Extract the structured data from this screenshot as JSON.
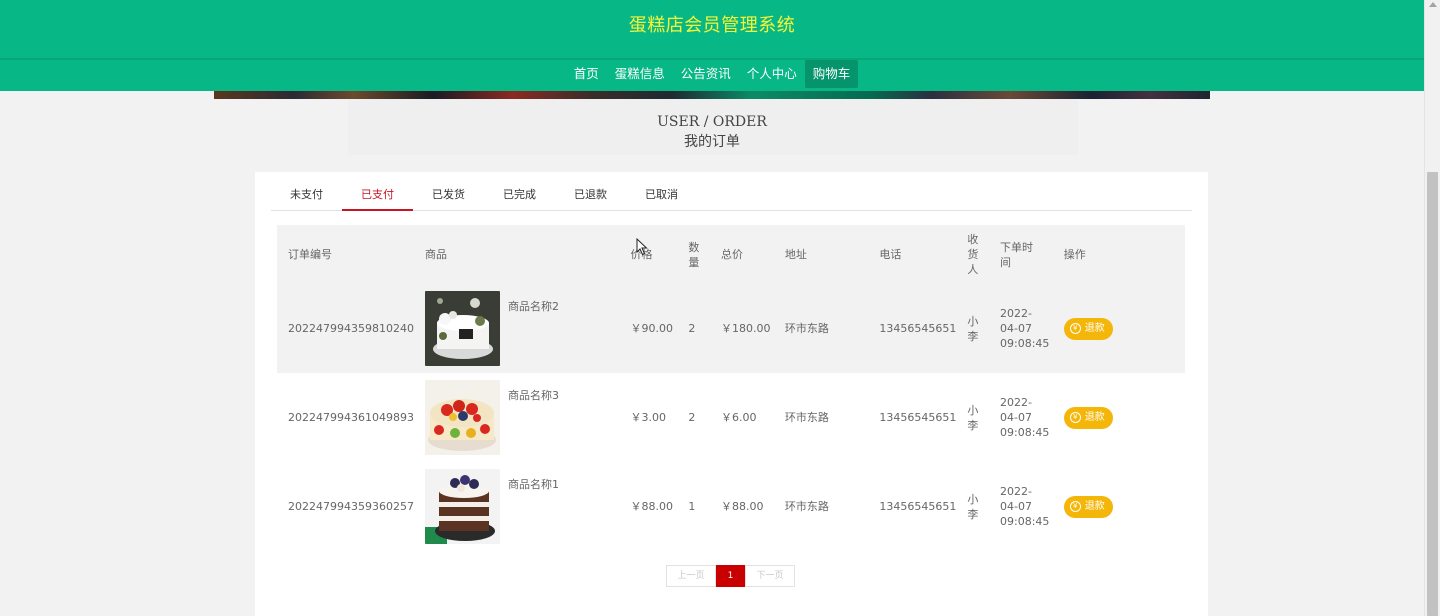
{
  "header": {
    "site_title": "蛋糕店会员管理系统",
    "nav": [
      "首页",
      "蛋糕信息",
      "公告资讯",
      "个人中心",
      "购物车"
    ],
    "active_nav_index": 4
  },
  "section": {
    "title_en": "USER / ORDER",
    "title_cn": "我的订单"
  },
  "tabs": {
    "items": [
      "未支付",
      "已支付",
      "已发货",
      "已完成",
      "已退款",
      "已取消"
    ],
    "active_index": 1
  },
  "table": {
    "headers": {
      "order_no": "订单编号",
      "goods": "商品",
      "price": "价格",
      "qty": "数量",
      "total": "总价",
      "address": "地址",
      "phone": "电话",
      "receiver": "收货人",
      "order_time": "下单时间",
      "action": "操作"
    },
    "rows": [
      {
        "order_no": "202247994359810240",
        "goods_name": "商品名称2",
        "price": "￥90.00",
        "qty": "2",
        "total": "￥180.00",
        "address": "环市东路",
        "phone": "13456545651",
        "receiver": "小李",
        "order_time": "2022-04-07 09:08:45",
        "action": "退款",
        "image": "cake-white-flowers"
      },
      {
        "order_no": "202247994361049893",
        "goods_name": "商品名称3",
        "price": "￥3.00",
        "qty": "2",
        "total": "￥6.00",
        "address": "环市东路",
        "phone": "13456545651",
        "receiver": "小李",
        "order_time": "2022-04-07 09:08:45",
        "action": "退款",
        "image": "cake-strawberry-fruit"
      },
      {
        "order_no": "202247994359360257",
        "goods_name": "商品名称1",
        "price": "￥88.00",
        "qty": "1",
        "total": "￥88.00",
        "address": "环市东路",
        "phone": "13456545651",
        "receiver": "小李",
        "order_time": "2022-04-07 09:08:45",
        "action": "退款",
        "image": "cake-chocolate-layer"
      }
    ]
  },
  "pagination": {
    "prev": "上一页",
    "current": "1",
    "next": "下一页"
  },
  "colors": {
    "header_bg": "#07b785",
    "title": "#f6f637",
    "active_tab": "#c81423",
    "refund_btn": "#f5b60a",
    "current_page": "#c80000"
  }
}
